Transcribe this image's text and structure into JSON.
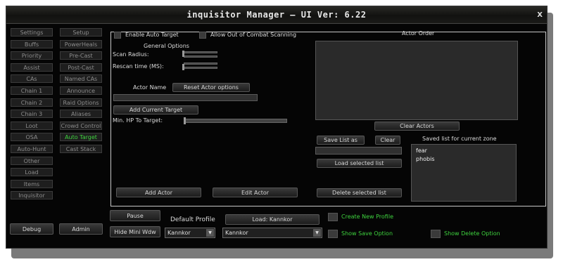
{
  "window": {
    "title": "inquisitor Manager  – UI Ver: 6.22",
    "close": "X"
  },
  "nav_left": [
    "Settings",
    "Buffs",
    "Priority",
    "Assist",
    "CAs",
    "Chain 1",
    "Chain 2",
    "Chain 3",
    "Loot",
    "OSA",
    "Auto-Hunt",
    "Other",
    "Load",
    "Items",
    "Inquisitor"
  ],
  "nav_right": [
    "Setup",
    "PowerHeals",
    "Pre-Cast",
    "Post-Cast",
    "Named CAs",
    "Announce",
    "Raid Options",
    "Aliases",
    "Crowd Control",
    "Auto Target",
    "Cast Stack"
  ],
  "active_nav": "Auto Target",
  "bottom_left": {
    "debug": "Debug",
    "admin": "Admin"
  },
  "main": {
    "enable_auto_target": "Enable Auto Target",
    "allow_out_of_combat": "Allow Out of Combat Scanning",
    "general_options": "General Options",
    "scan_radius": "Scan Radius:",
    "rescan_time": "Rescan time (MS):",
    "actor_name": "Actor Name",
    "reset_actor_options": "Reset Actor options",
    "add_current_target": "Add Current Target",
    "min_hp_to_target": "Min. HP To Target:",
    "add_actor": "Add Actor",
    "edit_actor": "Edit Actor",
    "actor_order": "Actor Order",
    "clear_actors": "Clear Actors",
    "save_list_as": "Save List as",
    "clear": "Clear",
    "load_selected_list": "Load selected list",
    "delete_selected_list": "Delete selected list",
    "saved_list_title": "Saved list for current zone",
    "saved_lists": [
      "fear",
      "phobis"
    ]
  },
  "footer": {
    "pause": "Pause",
    "hide_mini": "Hide Mini Wdw",
    "default_profile": "Default Profile",
    "load_profile": "Load: Kannkor",
    "profile_select_left": "Kannkor",
    "profile_select_right": "Kannkor",
    "create_new_profile": "Create New Profile",
    "show_save_option": "Show Save Option",
    "show_delete_option": "Show Delete Option"
  },
  "colors": {
    "accent_green": "#3ed23e",
    "background": "#050505"
  }
}
